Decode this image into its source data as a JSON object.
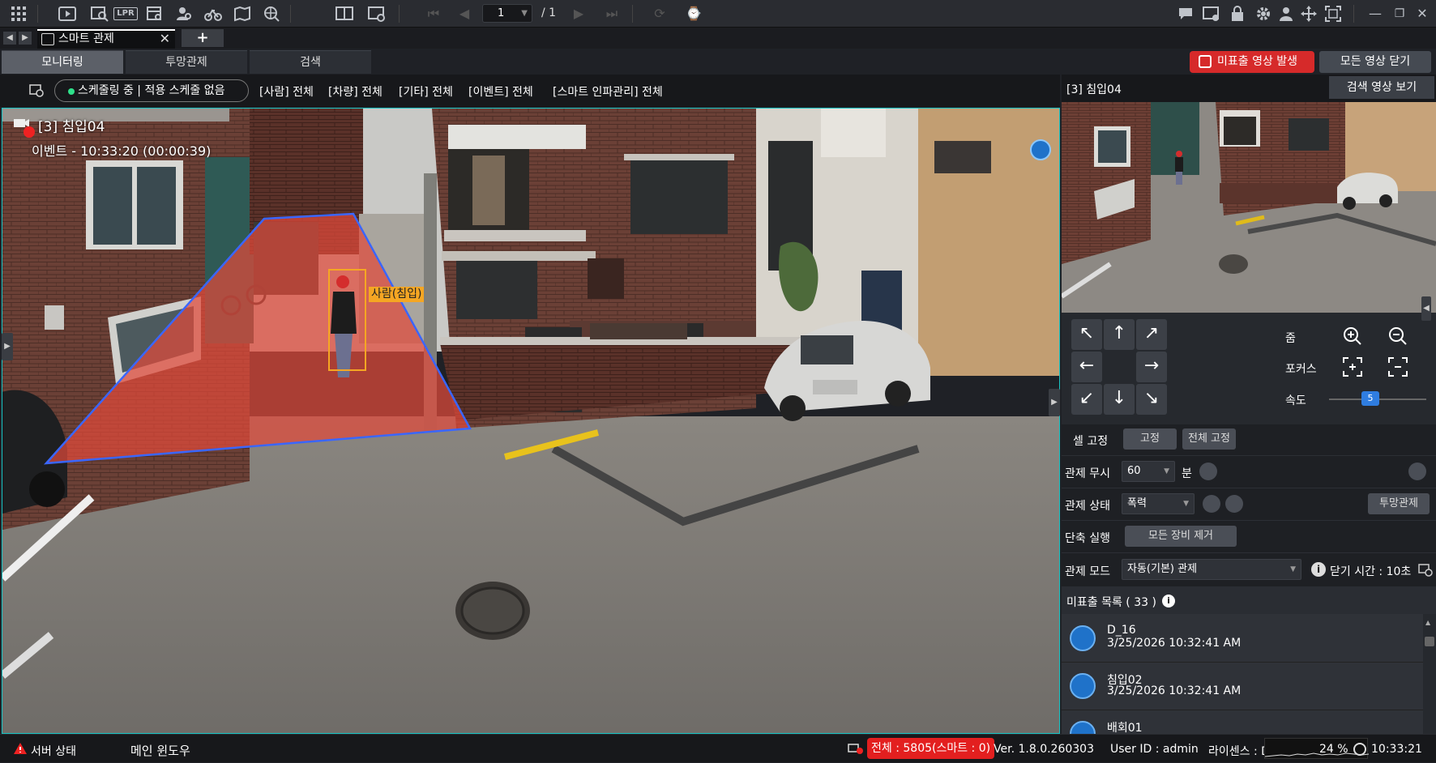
{
  "toolbar": {
    "page_current": "1",
    "page_total": "/ 1",
    "left_icons": [
      "grid-icon",
      "playback-icon",
      "search-video-icon",
      "lpr-icon",
      "calendar-search-icon",
      "face-search-icon",
      "bike-icon",
      "map-search-icon",
      "globe-search-icon"
    ],
    "lpr_label": "LPR"
  },
  "tabs": {
    "doc_tab_label": "스마트 관제",
    "add_tab_label": "+"
  },
  "view_tabs": [
    "모니터링",
    "투망관제",
    "검색"
  ],
  "header_buttons": {
    "alert_label": "미표출 영상 발생",
    "close_all_label": "모든 영상 닫기"
  },
  "filters": {
    "schedule_label": "스케줄링 중 | 적용 스케줄 없음",
    "items": [
      "[사람] 전체",
      "[차량] 전체",
      "[기타] 전체",
      "[이벤트] 전체",
      "[스마트 인파관리] 전체"
    ]
  },
  "video": {
    "camera_title": "[3] 침입04",
    "event_line": "이벤트 - 10:33:20 (00:00:39)",
    "detection_label": "사람(침입)"
  },
  "side": {
    "camera_name": "[3] 침입04",
    "search_video_label": "검색 영상 보기"
  },
  "ptz": {
    "zoom_label": "줌",
    "focus_label": "포커스",
    "speed_label": "속도",
    "speed_value": "5",
    "arrows": [
      "↖",
      "↑",
      "↗",
      "←",
      "→",
      "↙",
      "↓",
      "↘"
    ]
  },
  "controls": {
    "cell_fix_label": "셀 고정",
    "fix_btn": "고정",
    "fix_all_btn": "전체 고정",
    "ignore_label": "관제 무시",
    "ignore_value": "60",
    "ignore_unit": "분",
    "status_label": "관제 상태",
    "status_value": "폭력",
    "net_control_btn": "투망관제",
    "shortcut_label": "단축 실행",
    "remove_all_btn": "모든 장비 제거",
    "mode_label": "관제 모드",
    "mode_value": "자동(기본) 관제",
    "close_time_label": "닫기 시간 : 10초"
  },
  "list": {
    "title": "미표출 목록 ( 33 )",
    "items": [
      {
        "name": "D_16",
        "time": "3/25/2026 10:32:41 AM"
      },
      {
        "name": "침입02",
        "time": "3/25/2026 10:32:41 AM"
      },
      {
        "name": "배회01",
        "time": ""
      }
    ]
  },
  "status": {
    "server_status": "서버 상태",
    "main_window": "메인 윈도우",
    "total": "전체 : 5805(스마트 : 0)",
    "version": "Ver. 1.8.0.260303",
    "user": "User ID : admin",
    "license": "라이센스 : D-58",
    "cpu": "24 %",
    "clock": "10:33:21"
  },
  "colors": {
    "accent_red": "#d62a2a",
    "zone_fill": "#e04a3a",
    "zone_stroke": "#3a66ff",
    "detect_box": "#f5a623",
    "video_border": "#18c4c4"
  }
}
